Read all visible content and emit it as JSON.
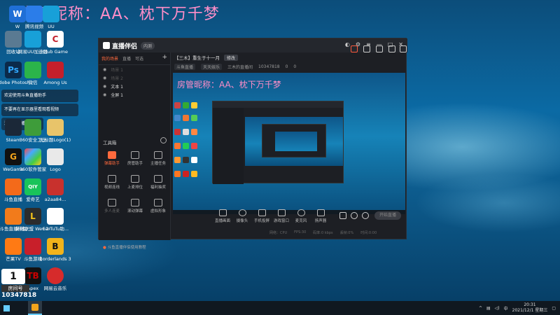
{
  "overlay_title": "房管昵称：AA、枕下万千梦",
  "desktop_icons": [
    {
      "name": "w-icon",
      "label": "W",
      "color": "#1f6fd6"
    },
    {
      "name": "recycle-icon",
      "label": "回收站",
      "color": "#5a7a92"
    },
    {
      "name": "ps-icon",
      "label": "Adobe Photosh...",
      "color": "#0b2a4a"
    },
    {
      "name": "qq-chat-icon",
      "label": "微信",
      "color": "#2bb44a"
    },
    {
      "name": "among-us-icon",
      "label": "Among Us",
      "color": "#c41f2b"
    },
    {
      "name": "steam-icon",
      "label": "Steam",
      "color": "#1b2838"
    },
    {
      "name": "safe360-icon",
      "label": "360安全卫士",
      "color": "#3e9c3a"
    },
    {
      "name": "folder-icon",
      "label": "无标题Logo(1)",
      "color": "#e8c46a"
    },
    {
      "name": "wegame-icon",
      "label": "WeGame",
      "color": "#111111"
    },
    {
      "name": "app-store-icon",
      "label": "360软件管家",
      "color": "#d6403a"
    },
    {
      "name": "logo-file-icon",
      "label": "Logo",
      "color": "#e9e9e9"
    },
    {
      "name": "huya-icon",
      "label": "斗鱼直播",
      "color": "#f46a1a"
    },
    {
      "name": "iqiyi-icon",
      "label": "爱奇艺",
      "color": "#19c35a"
    },
    {
      "name": "zip-icon",
      "label": "a2aa84...",
      "color": "#c8312d"
    },
    {
      "name": "huya-assist-icon",
      "label": "斗鱼直播伴侣",
      "color": "#f27b1b"
    },
    {
      "name": "wegame-new-icon",
      "label": "英雄联盟 WeGame版",
      "color": "#2c2c2c"
    },
    {
      "name": "tutu-icon",
      "label": "+2-TuTu助...",
      "color": "#ffffff"
    },
    {
      "name": "mango-icon",
      "label": "芒果TV",
      "color": "#ff7a14"
    },
    {
      "name": "redgame-icon",
      "label": "斗鱼游戏",
      "color": "#c81f2a"
    },
    {
      "name": "borderlands-icon",
      "label": "Borderlands 3",
      "color": "#f2b31a"
    },
    {
      "name": "qq-icon",
      "label": "腾讯QQ",
      "color": "#f0f0f0"
    },
    {
      "name": "apex-icon",
      "label": "Apex",
      "color": "#111111"
    },
    {
      "name": "netease-music-icon",
      "label": "网易云音乐",
      "color": "#d62b2b"
    }
  ],
  "top_icons": [
    {
      "label": "腾讯视频",
      "color": "#2b7de9"
    },
    {
      "label": "网易UU加速器",
      "color": "#18a0d8"
    },
    {
      "label": "Club Game",
      "color": "#ffffff"
    }
  ],
  "notifications": [
    "欢迎使用斗鱼直播助手",
    "不要再在显示器里看观看视频",
    "添加新直播"
  ],
  "room": {
    "badge": "1",
    "tag": "房间号",
    "number": "10347818"
  },
  "app": {
    "name": "直播伴侣",
    "version": "内测",
    "tabs": [
      "我的场景",
      "直播",
      "可选"
    ],
    "scenes": [
      {
        "label": "场景 1",
        "dim": true
      },
      {
        "label": "场景 2",
        "dim": true
      },
      {
        "label": "文本 1",
        "dim": false
      },
      {
        "label": "全屏 1",
        "dim": false
      }
    ],
    "tools_head": "工具箱",
    "tools": [
      {
        "label": "弹幕助手",
        "hot": true
      },
      {
        "label": "房管助手",
        "hot": false
      },
      {
        "label": "主播任务",
        "hot": false
      },
      {
        "label": "视频连线",
        "hot": false
      },
      {
        "label": "上麦排位",
        "hot": false
      },
      {
        "label": "福利抽奖",
        "hot": false
      },
      {
        "label": "多人连麦",
        "hot": false
      },
      {
        "label": "滚动弹幕",
        "hot": false
      },
      {
        "label": "虚拟形象",
        "hot": false
      }
    ],
    "footer_warn": "斗鱼直播伴侣使用教程",
    "live_title": "【三木】重生于十一月",
    "edit_label": "修改",
    "meta": [
      "斗鱼直播",
      "天天娱乐",
      "三木的直播间",
      "10347818",
      "0",
      "0"
    ],
    "preview_title": "房管昵称：AA、枕下万千梦",
    "controls": [
      "直播画面",
      "摄像头",
      "手机投屏",
      "游戏窗口",
      "麦克风",
      "扬声器"
    ],
    "start_label": "开始直播",
    "status": [
      "网络：CPU",
      "FPS:30",
      "码率:0 kbps",
      "丢帧:0%",
      "时间:0:00"
    ]
  },
  "taskbar": {
    "time": "20:31",
    "date": "2021/12/1 星期三"
  }
}
